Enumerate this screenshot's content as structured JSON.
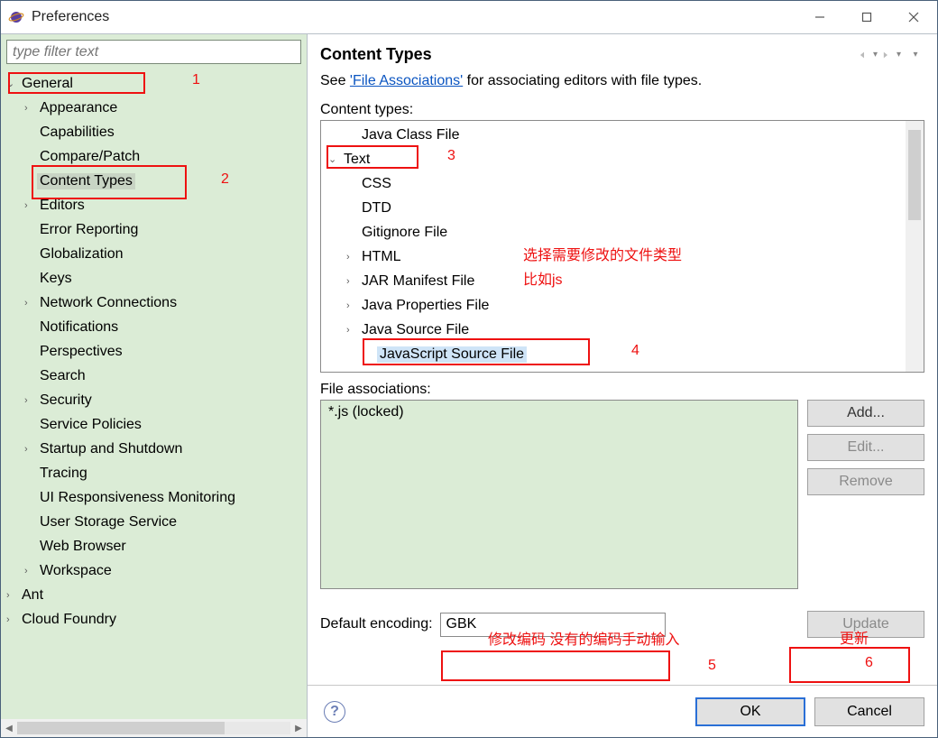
{
  "window": {
    "title": "Preferences"
  },
  "filter_placeholder": "type filter text",
  "left_tree": [
    {
      "level": 0,
      "expanded": true,
      "label": "General",
      "hasChildren": true
    },
    {
      "level": 1,
      "expanded": false,
      "label": "Appearance",
      "hasChildren": true
    },
    {
      "level": 1,
      "label": "Capabilities"
    },
    {
      "level": 1,
      "label": "Compare/Patch"
    },
    {
      "level": 1,
      "label": "Content Types",
      "selected": true
    },
    {
      "level": 1,
      "expanded": false,
      "label": "Editors",
      "hasChildren": true
    },
    {
      "level": 1,
      "label": "Error Reporting"
    },
    {
      "level": 1,
      "label": "Globalization"
    },
    {
      "level": 1,
      "label": "Keys"
    },
    {
      "level": 1,
      "expanded": false,
      "label": "Network Connections",
      "hasChildren": true
    },
    {
      "level": 1,
      "label": "Notifications"
    },
    {
      "level": 1,
      "label": "Perspectives"
    },
    {
      "level": 1,
      "label": "Search"
    },
    {
      "level": 1,
      "expanded": false,
      "label": "Security",
      "hasChildren": true
    },
    {
      "level": 1,
      "label": "Service Policies"
    },
    {
      "level": 1,
      "expanded": false,
      "label": "Startup and Shutdown",
      "hasChildren": true
    },
    {
      "level": 1,
      "label": "Tracing"
    },
    {
      "level": 1,
      "label": "UI Responsiveness Monitoring"
    },
    {
      "level": 1,
      "label": "User Storage Service"
    },
    {
      "level": 1,
      "label": "Web Browser"
    },
    {
      "level": 1,
      "expanded": false,
      "label": "Workspace",
      "hasChildren": true
    },
    {
      "level": 0,
      "expanded": false,
      "label": "Ant",
      "hasChildren": true
    },
    {
      "level": 0,
      "expanded": false,
      "label": "Cloud Foundry",
      "hasChildren": true
    }
  ],
  "page_title": "Content Types",
  "intro_prefix": "See ",
  "intro_link": "'File Associations'",
  "intro_suffix": " for associating editors with file types.",
  "ct_label": "Content types:",
  "ct_tree": [
    {
      "level": 1,
      "label": "Java Class File"
    },
    {
      "level": 0,
      "expanded": true,
      "label": "Text",
      "hasChildren": true
    },
    {
      "level": 1,
      "label": "CSS"
    },
    {
      "level": 1,
      "label": "DTD"
    },
    {
      "level": 1,
      "label": "Gitignore File"
    },
    {
      "level": 1,
      "expanded": false,
      "label": "HTML",
      "hasChildren": true
    },
    {
      "level": 1,
      "expanded": false,
      "label": "JAR Manifest File",
      "hasChildren": true
    },
    {
      "level": 1,
      "expanded": false,
      "label": "Java Properties File",
      "hasChildren": true
    },
    {
      "level": 1,
      "expanded": false,
      "label": "Java Source File",
      "hasChildren": true
    },
    {
      "level": 2,
      "label": "JavaScript Source File",
      "selected": true
    }
  ],
  "fa_label": "File associations:",
  "fa_item": "*.js (locked)",
  "buttons": {
    "add": "Add...",
    "edit": "Edit...",
    "remove": "Remove",
    "update": "Update",
    "ok": "OK",
    "cancel": "Cancel"
  },
  "encoding_label": "Default encoding:",
  "encoding_value": "GBK",
  "annotations": {
    "n1": "1",
    "n2": "2",
    "n3": "3",
    "n4": "4",
    "n5": "5",
    "n6": "6",
    "txt_sel_type": "选择需要修改的文件类型",
    "txt_js": "比如js",
    "txt_enc": "修改编码 没有的编码手动输入",
    "txt_update": "更新"
  }
}
